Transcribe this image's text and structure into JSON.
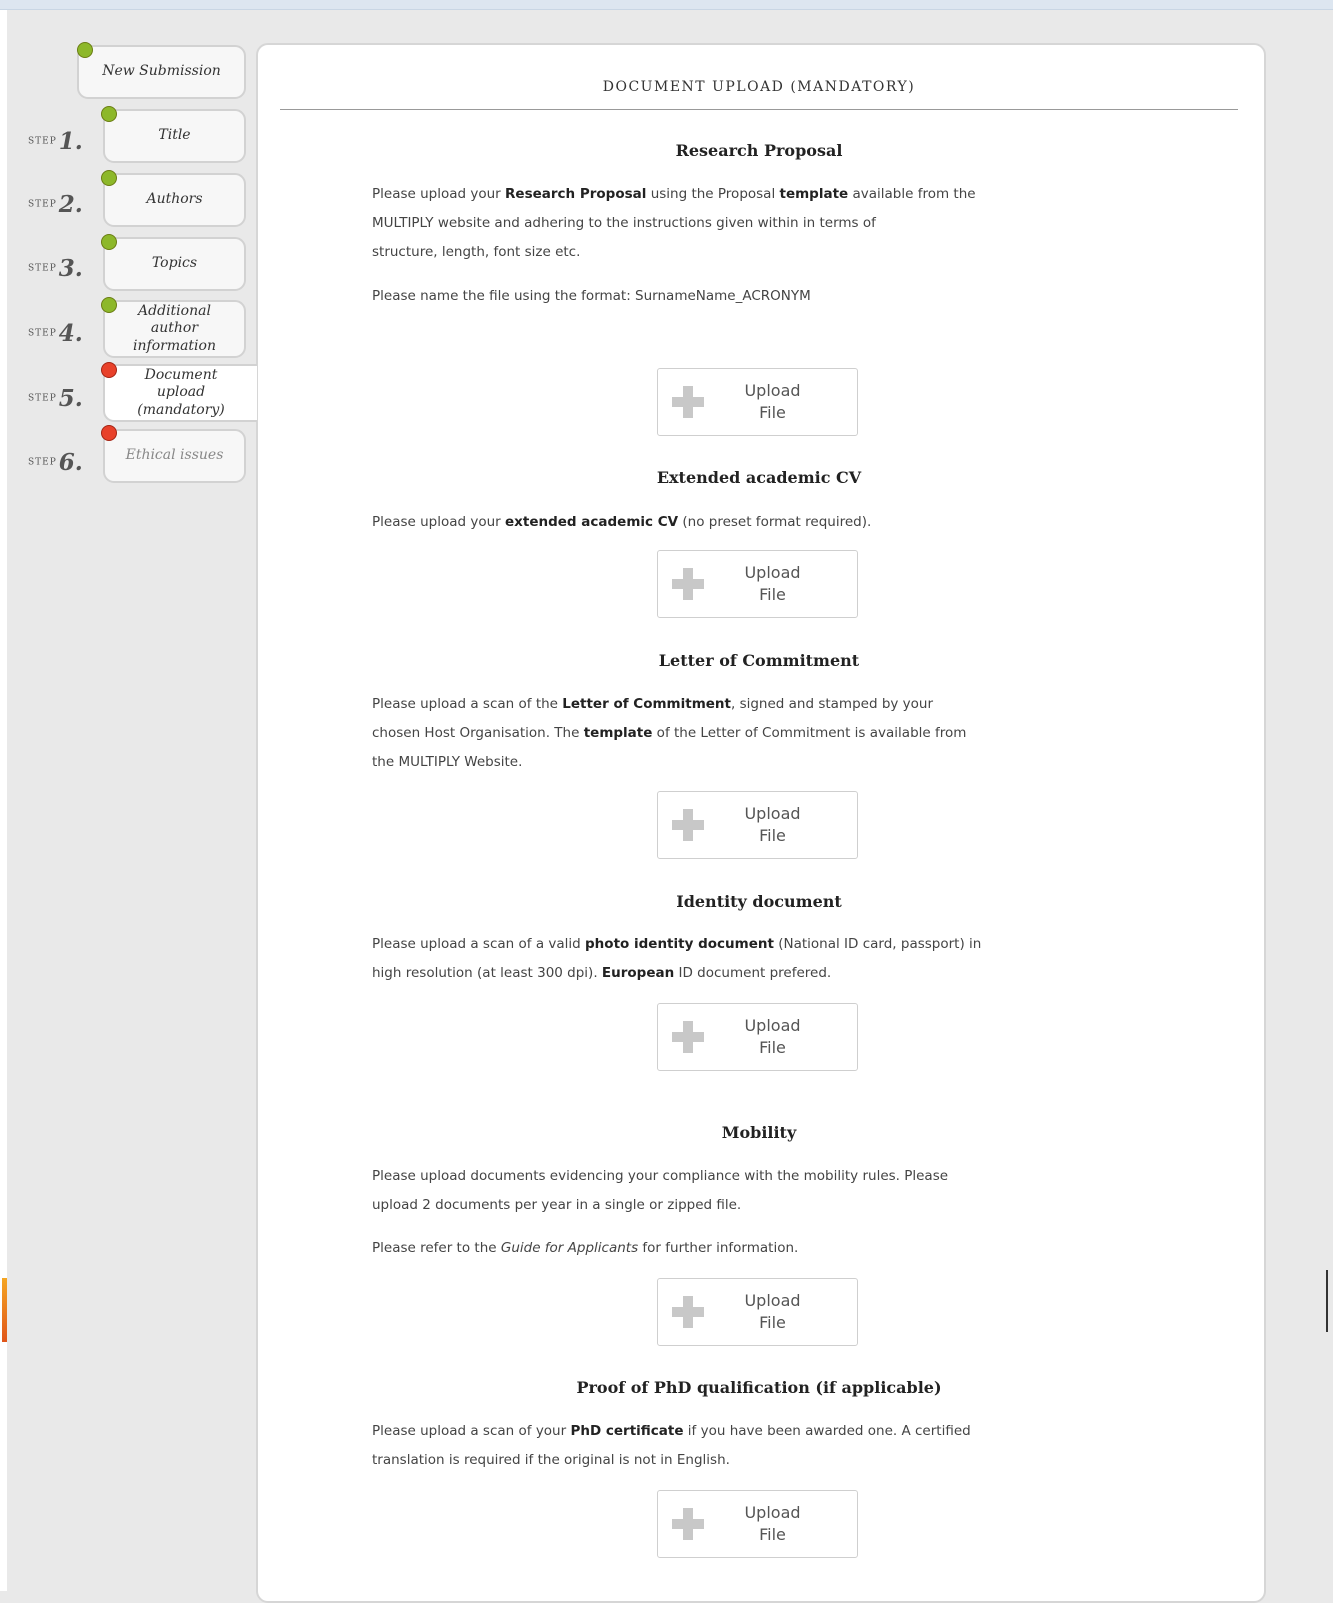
{
  "colors": {
    "step_complete": "#8db82a",
    "step_incomplete": "#e8412a"
  },
  "steps": [
    {
      "step_word": "",
      "number": "",
      "label": "New Submission",
      "status": "complete",
      "icon": "status-dot-icon"
    },
    {
      "step_word": "STEP",
      "number": "1.",
      "label": "Title",
      "status": "complete",
      "icon": "status-dot-icon"
    },
    {
      "step_word": "STEP",
      "number": "2.",
      "label": "Authors",
      "status": "complete",
      "icon": "status-dot-icon"
    },
    {
      "step_word": "STEP",
      "number": "3.",
      "label": "Topics",
      "status": "complete",
      "icon": "status-dot-icon"
    },
    {
      "step_word": "STEP",
      "number": "4.",
      "label": "Additional author information",
      "status": "complete",
      "icon": "status-dot-icon"
    },
    {
      "step_word": "STEP",
      "number": "5.",
      "label": "Document upload (mandatory)",
      "status": "incomplete",
      "active": true,
      "icon": "status-dot-icon"
    },
    {
      "step_word": "STEP",
      "number": "6.",
      "label": "Ethical issues",
      "status": "incomplete",
      "icon": "status-dot-icon"
    }
  ],
  "panel": {
    "title": "DOCUMENT UPLOAD (MANDATORY)"
  },
  "upload": {
    "line1": "Upload",
    "line2": "File",
    "icon": "plus-icon"
  },
  "sections": [
    {
      "heading": "Research Proposal",
      "paragraphs": [
        [
          {
            "t": "Please upload your "
          },
          {
            "b": "Research Proposal"
          },
          {
            "t": " using the Proposal "
          },
          {
            "b": "template"
          },
          {
            "t": " available from the"
          },
          {
            "br": true
          },
          {
            "t": "MULTIPLY website and adhering to the instructions given within in terms of"
          },
          {
            "br": true
          },
          {
            "t": "structure, length, font size etc."
          }
        ],
        [
          {
            "t": "Please name the file using the format: SurnameName_ACRONYM"
          }
        ]
      ]
    },
    {
      "heading": "Extended academic CV",
      "paragraphs": [
        [
          {
            "t": "Please upload your "
          },
          {
            "b": "extended academic CV"
          },
          {
            "t": " (no preset format required)."
          }
        ]
      ]
    },
    {
      "heading": "Letter of Commitment",
      "paragraphs": [
        [
          {
            "t": "Please upload a scan of the "
          },
          {
            "b": "Letter of Commitment"
          },
          {
            "t": ", signed and stamped by your"
          },
          {
            "br": true
          },
          {
            "t": "chosen Host Organisation. The "
          },
          {
            "b": "template"
          },
          {
            "t": " of the Letter of Commitment is available from"
          },
          {
            "br": true
          },
          {
            "t": "the MULTIPLY Website."
          }
        ]
      ]
    },
    {
      "heading": "Identity document",
      "paragraphs": [
        [
          {
            "t": "Please upload a scan of a valid "
          },
          {
            "b": "photo identity document"
          },
          {
            "t": " (National ID card, passport) in"
          },
          {
            "br": true
          },
          {
            "t": "high resolution (at least 300 dpi). "
          },
          {
            "b": "European"
          },
          {
            "t": " ID document prefered."
          }
        ]
      ]
    },
    {
      "heading": "Mobility",
      "paragraphs": [
        [
          {
            "t": "Please upload documents evidencing your compliance with the mobility rules. Please"
          },
          {
            "br": true
          },
          {
            "t": "upload 2 documents per year in a single or zipped file."
          }
        ],
        [
          {
            "t": "Please refer to the "
          },
          {
            "i": "Guide for Applicants"
          },
          {
            "t": " for further information."
          }
        ]
      ]
    },
    {
      "heading": "Proof of PhD qualification (if applicable)",
      "paragraphs": [
        [
          {
            "t": "Please upload a scan of your "
          },
          {
            "b": "PhD certificate"
          },
          {
            "t": " if you have been awarded one. A certified"
          },
          {
            "br": true
          },
          {
            "t": "translation is required if the original is not in English."
          }
        ]
      ]
    }
  ]
}
